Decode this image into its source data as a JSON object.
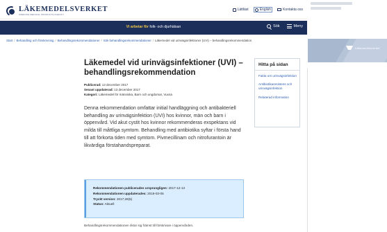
{
  "header": {
    "brand_name": "LÄKEMEDELSVERKET",
    "brand_sub": "SWEDISH MEDICAL PRODUCTS AGENCY",
    "utility": [
      {
        "label": "Lättläst",
        "icon": "easy-read-icon"
      },
      {
        "label": "English",
        "icon": "globe-icon"
      },
      {
        "label": "Kontakta oss",
        "icon": "mail-icon"
      }
    ]
  },
  "nav": {
    "tagline_prefix": "Vi arbetar för",
    "tagline_rest": " folk- och djurhälsan",
    "search_label": "Sök",
    "menu_label": "Meny"
  },
  "breadcrumb": {
    "items": [
      "Start",
      "Behandling och förskrivning",
      "Behandlingsrekommendationer",
      "Sök behandlingsrekommendationer"
    ],
    "current": "Läkemedel vid urinvägsinfektioner (UVI) – behandlingsrekommendation"
  },
  "article": {
    "title": "Läkemedel vid urinvägsinfektioner (UVI) – behandlingsrekommendation",
    "meta": [
      {
        "label": "Publicerad:",
        "value": "13 december 2017"
      },
      {
        "label": "Senast uppdaterad:",
        "value": "13 december 2017"
      },
      {
        "label": "Kategori:",
        "value": "Läkemedel för människa, Barn och ungdomar, Vuxna"
      }
    ],
    "lead": "Denna rekommendation omfattar initial handläggning och antibakteriell behandling av urinvägsinfektion (UVI) hos kvinnor, män och barn i öppenvård. Vid akut cystit hos kvinnor rekommenderas exspektans vid milda till måttliga symtom. Behandling med antibiotika syftar i första hand till att förkorta tiden med symtom. Pivmecillinam och nitrofurantoin är likvärdiga förstahandspreparat.",
    "info": [
      {
        "label": "Rekommendationen publicerades ursprungligen:",
        "value": "2017-12-13"
      },
      {
        "label": "Rekommendationen uppdaterades:",
        "value": "2019-03-05"
      },
      {
        "label": "Tryckt version:",
        "value": "2017;28(5)"
      },
      {
        "label": "Status:",
        "value": "Aktuell"
      }
    ],
    "footer": "Behandlingsrekommendationen riktar sig främst till förskrivare i öppenvården."
  },
  "aside": {
    "title": "Hitta på sidan",
    "links": [
      "Fakta om urinvägsinfektion",
      "Antibiotikaresistens och urinvägsinfektion",
      "Relaterad information"
    ]
  },
  "overlay": {
    "logo_text": "Läkemedelsverket"
  },
  "colors": {
    "navy": "#1b2f5a",
    "accent_yellow": "#f3c846",
    "link_blue": "#2c5db0",
    "info_bg": "#dbeeff"
  }
}
